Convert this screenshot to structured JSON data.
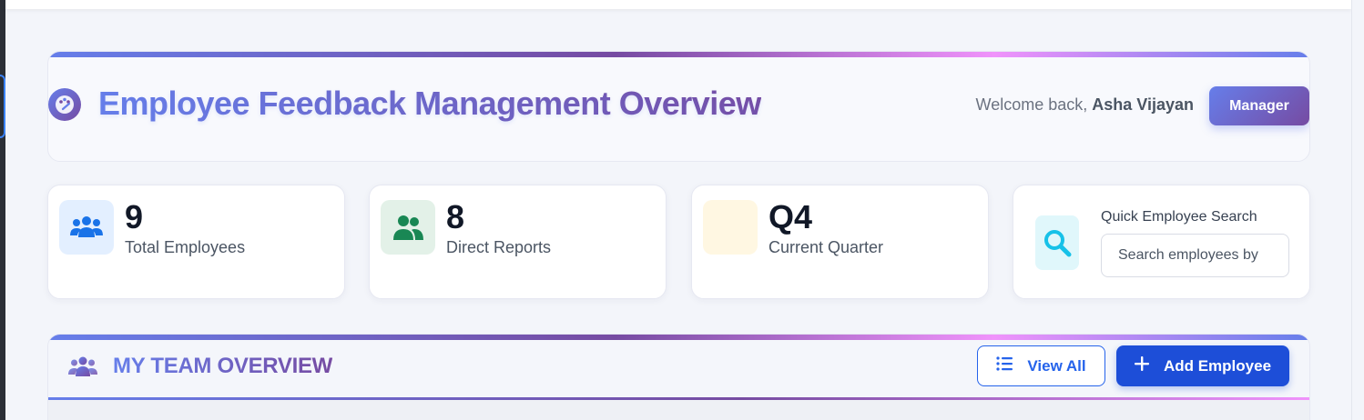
{
  "header": {
    "title": "Employee Feedback Management Overview",
    "welcome_prefix": "Welcome back,",
    "user_name": "Asha Vijayan",
    "role": "Manager",
    "logo_icon": "palette-icon"
  },
  "stats": [
    {
      "value": "9",
      "label": "Total Employees",
      "icon": "users-icon",
      "color": "#1a73e8",
      "bg": "#e3efff"
    },
    {
      "value": "8",
      "label": "Direct Reports",
      "icon": "user-friends-icon",
      "color": "#198754",
      "bg": "#e3f1e8"
    },
    {
      "value": "Q4",
      "label": "Current Quarter",
      "icon": "calendar-icon",
      "color": "#f5b400",
      "bg": "#fff7e2"
    }
  ],
  "search": {
    "title": "Quick Employee Search",
    "placeholder": "Search employees by",
    "icon": "search-icon",
    "color": "#17c1e8"
  },
  "team": {
    "title": "MY TEAM OVERVIEW",
    "view_all_label": "View All",
    "add_employee_label": "Add Employee"
  },
  "colors": {
    "accent_start": "#667eea",
    "accent_end": "#764ba2",
    "accent_pink": "#f093fb",
    "primary_button": "#1d4ed8"
  }
}
